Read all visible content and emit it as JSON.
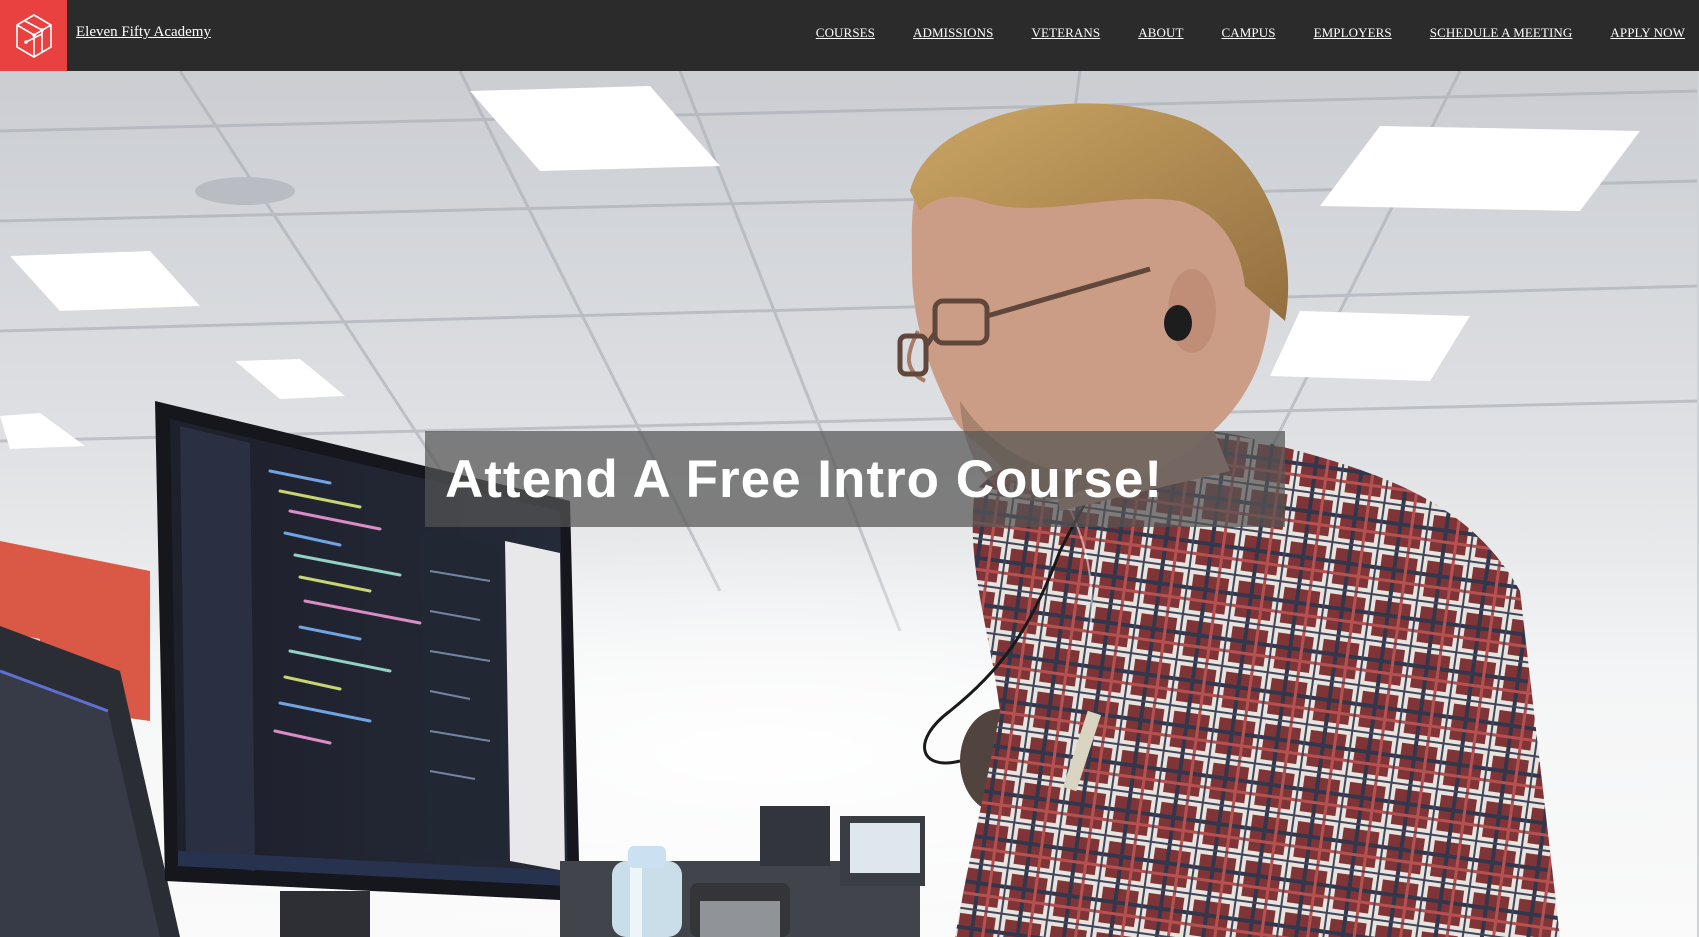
{
  "brand": {
    "name": "Eleven Fifty Academy",
    "logo_icon": "geometric-cube-logo-icon",
    "accent_color": "#e8413f"
  },
  "nav": {
    "background": "#2b2b2b",
    "items": [
      {
        "label": "COURSES"
      },
      {
        "label": "ADMISSIONS"
      },
      {
        "label": "VETERANS"
      },
      {
        "label": "ABOUT"
      },
      {
        "label": "CAMPUS"
      },
      {
        "label": "EMPLOYERS"
      },
      {
        "label": "SCHEDULE A MEETING"
      },
      {
        "label": "APPLY NOW"
      }
    ]
  },
  "hero": {
    "headline": "Attend A Free Intro Course!",
    "media": "classroom-video-still"
  }
}
